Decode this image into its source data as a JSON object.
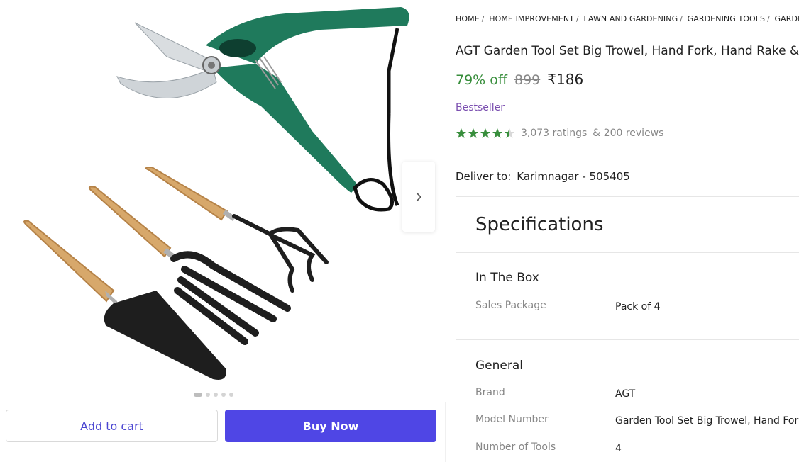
{
  "breadcrumb": [
    "HOME",
    "HOME IMPROVEMENT",
    "LAWN AND GARDENING",
    "GARDENING TOOLS",
    "GARDEN TO"
  ],
  "product": {
    "title": "AGT Garden Tool Set Big Trowel, Hand Fork, Hand Rake & Pr",
    "discount": "79% off",
    "mrp": "899",
    "price": "₹186",
    "badge": "Bestseller",
    "rating_value": 4.5,
    "ratings_count": "3,073 ratings",
    "reviews": "& 200 reviews",
    "image_icon": "garden-tool-set-image"
  },
  "gallery": {
    "count": 5,
    "active": 0,
    "next_icon": "chevron-right-icon"
  },
  "delivery": {
    "label": "Deliver to:",
    "location": "Karimnagar - 505405"
  },
  "actions": {
    "add_to_cart": "Add to cart",
    "buy_now": "Buy Now"
  },
  "specifications": {
    "title": "Specifications",
    "sections": [
      {
        "heading": "In The Box",
        "rows": [
          {
            "key": "Sales Package",
            "value": "Pack of 4"
          }
        ]
      },
      {
        "heading": "General",
        "rows": [
          {
            "key": "Brand",
            "value": "AGT"
          },
          {
            "key": "Model Number",
            "value": "Garden Tool Set Big Trowel, Hand Fork"
          },
          {
            "key": "Number of Tools",
            "value": "4"
          }
        ]
      }
    ]
  },
  "colors": {
    "accent": "#4f46e5",
    "discount": "#388e3c",
    "bestseller": "#7b4fb0",
    "star": "#388e3c",
    "secateur_handle": "#1f7a5c"
  }
}
